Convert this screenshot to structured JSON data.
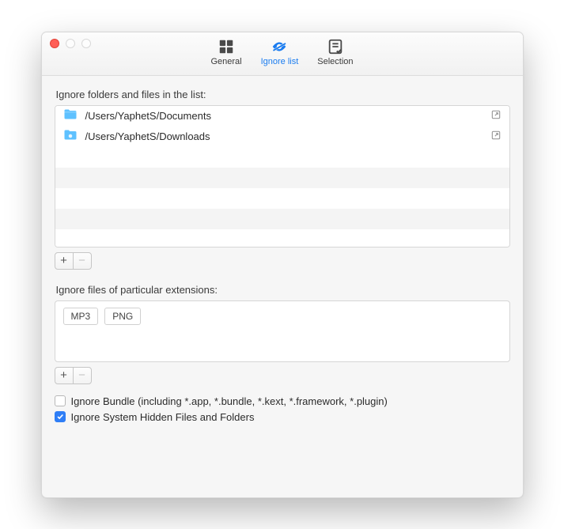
{
  "toolbar": {
    "general": "General",
    "ignore": "Ignore list",
    "selection": "Selection"
  },
  "labels": {
    "folders": "Ignore folders and files in the list:",
    "extensions": "Ignore files of particular extensions:"
  },
  "folders": [
    {
      "path": "/Users/YaphetS/Documents"
    },
    {
      "path": "/Users/YaphetS/Downloads"
    }
  ],
  "extensions": [
    "MP3",
    "PNG"
  ],
  "checkboxes": {
    "bundle": {
      "label": "Ignore Bundle (including *.app, *.bundle, *.kext, *.framework, *.plugin)",
      "checked": false
    },
    "hidden": {
      "label": "Ignore System Hidden Files and Folders",
      "checked": true
    }
  },
  "buttons": {
    "plus": "+",
    "minus": "−"
  }
}
